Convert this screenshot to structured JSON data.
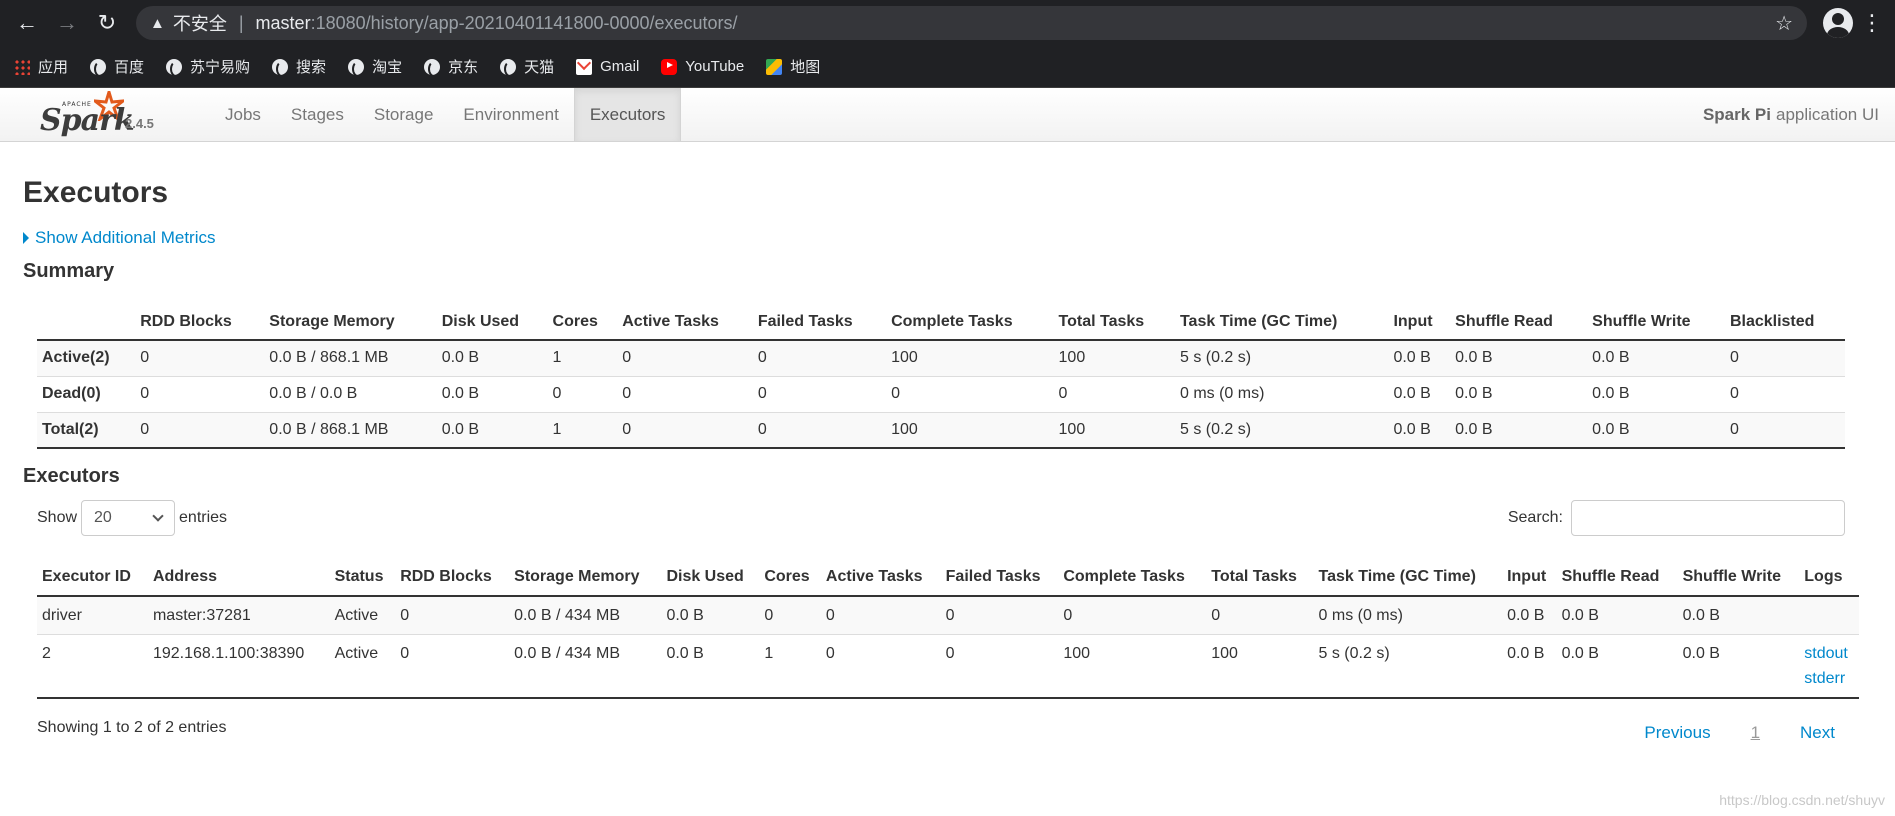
{
  "browser": {
    "security_label": "不安全",
    "url_host": "master",
    "url_rest": ":18080/history/app-20210401141800-0000/executors/",
    "bookmarks": [
      {
        "label": "应用",
        "icon": "apps-grid-icon"
      },
      {
        "label": "百度",
        "icon": "globe-icon"
      },
      {
        "label": "苏宁易购",
        "icon": "globe-icon"
      },
      {
        "label": "搜索",
        "icon": "globe-icon"
      },
      {
        "label": "淘宝",
        "icon": "globe-icon"
      },
      {
        "label": "京东",
        "icon": "globe-icon"
      },
      {
        "label": "天猫",
        "icon": "globe-icon"
      },
      {
        "label": "Gmail",
        "icon": "gmail-icon"
      },
      {
        "label": "YouTube",
        "icon": "youtube-icon"
      },
      {
        "label": "地图",
        "icon": "maps-icon"
      }
    ]
  },
  "navbar": {
    "logo_apache": "APACHE",
    "logo_word": "Spark",
    "version": "2.4.5",
    "tabs": [
      "Jobs",
      "Stages",
      "Storage",
      "Environment",
      "Executors"
    ],
    "active_tab": "Executors",
    "app_name": "Spark Pi",
    "app_suffix": "application UI",
    "accent_color": "#0088cc"
  },
  "page": {
    "title": "Executors",
    "additional_metrics": "Show Additional Metrics"
  },
  "summary": {
    "heading": "Summary",
    "columns": [
      "",
      "RDD Blocks",
      "Storage Memory",
      "Disk Used",
      "Cores",
      "Active Tasks",
      "Failed Tasks",
      "Complete Tasks",
      "Total Tasks",
      "Task Time (GC Time)",
      "Input",
      "Shuffle Read",
      "Shuffle Write",
      "Blacklisted"
    ],
    "rows": [
      [
        "Active(2)",
        "0",
        "0.0 B / 868.1 MB",
        "0.0 B",
        "1",
        "0",
        "0",
        "100",
        "100",
        "5 s (0.2 s)",
        "0.0 B",
        "0.0 B",
        "0.0 B",
        "0"
      ],
      [
        "Dead(0)",
        "0",
        "0.0 B / 0.0 B",
        "0.0 B",
        "0",
        "0",
        "0",
        "0",
        "0",
        "0 ms (0 ms)",
        "0.0 B",
        "0.0 B",
        "0.0 B",
        "0"
      ],
      [
        "Total(2)",
        "0",
        "0.0 B / 868.1 MB",
        "0.0 B",
        "1",
        "0",
        "0",
        "100",
        "100",
        "5 s (0.2 s)",
        "0.0 B",
        "0.0 B",
        "0.0 B",
        "0"
      ]
    ]
  },
  "executors": {
    "heading": "Executors",
    "show_label": "Show",
    "entries_label": "entries",
    "page_size": "20",
    "search_label": "Search:",
    "search_value": "",
    "columns": [
      "Executor ID",
      "Address",
      "Status",
      "RDD Blocks",
      "Storage Memory",
      "Disk Used",
      "Cores",
      "Active Tasks",
      "Failed Tasks",
      "Complete Tasks",
      "Total Tasks",
      "Task Time (GC Time)",
      "Input",
      "Shuffle Read",
      "Shuffle Write",
      "Logs"
    ],
    "rows": [
      {
        "cells": [
          "driver",
          "master:37281",
          "Active",
          "0",
          "0.0 B / 434 MB",
          "0.0 B",
          "0",
          "0",
          "0",
          "0",
          "0",
          "0 ms (0 ms)",
          "0.0 B",
          "0.0 B",
          "0.0 B"
        ],
        "logs": []
      },
      {
        "cells": [
          "2",
          "192.168.1.100:38390",
          "Active",
          "0",
          "0.0 B / 434 MB",
          "0.0 B",
          "1",
          "0",
          "0",
          "100",
          "100",
          "5 s (0.2 s)",
          "0.0 B",
          "0.0 B",
          "0.0 B"
        ],
        "logs": [
          "stdout",
          "stderr"
        ]
      }
    ],
    "info": "Showing 1 to 2 of 2 entries",
    "pager": {
      "previous": "Previous",
      "current": "1",
      "next": "Next"
    }
  },
  "watermark": "https://blog.csdn.net/shuyv"
}
